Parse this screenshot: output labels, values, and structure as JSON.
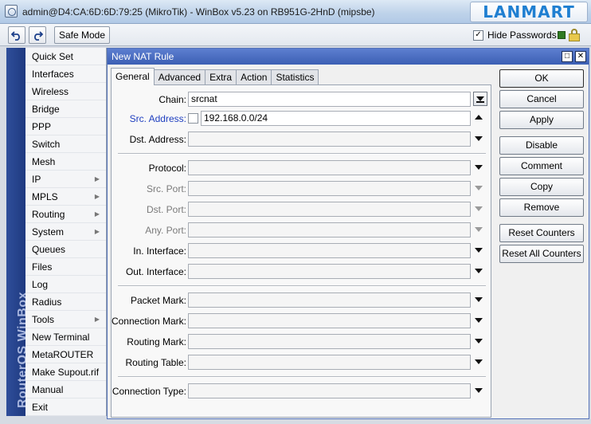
{
  "window": {
    "title": "admin@D4:CA:6D:6D:79:25 (MikroTik) - WinBox v5.23 on RB951G-2HnD (mipsbe)",
    "brand": "LANMART"
  },
  "toolbar": {
    "undo_icon": "undo-icon",
    "redo_icon": "redo-icon",
    "safe_mode_label": "Safe Mode",
    "hide_passwords_label": "Hide Passwords",
    "hide_passwords_checked": true,
    "status_color": "#2f7a22"
  },
  "sidebar": {
    "vertical_text": "RouterOS WinBox",
    "items": [
      {
        "label": "Quick Set",
        "submenu": false
      },
      {
        "label": "Interfaces",
        "submenu": false
      },
      {
        "label": "Wireless",
        "submenu": false
      },
      {
        "label": "Bridge",
        "submenu": false
      },
      {
        "label": "PPP",
        "submenu": false
      },
      {
        "label": "Switch",
        "submenu": false
      },
      {
        "label": "Mesh",
        "submenu": false
      },
      {
        "label": "IP",
        "submenu": true
      },
      {
        "label": "MPLS",
        "submenu": true
      },
      {
        "label": "Routing",
        "submenu": true
      },
      {
        "label": "System",
        "submenu": true
      },
      {
        "label": "Queues",
        "submenu": false
      },
      {
        "label": "Files",
        "submenu": false
      },
      {
        "label": "Log",
        "submenu": false
      },
      {
        "label": "Radius",
        "submenu": false
      },
      {
        "label": "Tools",
        "submenu": true
      },
      {
        "label": "New Terminal",
        "submenu": false
      },
      {
        "label": "MetaROUTER",
        "submenu": false
      },
      {
        "label": "Make Supout.rif",
        "submenu": false
      },
      {
        "label": "Manual",
        "submenu": false
      },
      {
        "label": "Exit",
        "submenu": false
      }
    ]
  },
  "dialog": {
    "title": "New NAT Rule",
    "tabs": [
      "General",
      "Advanced",
      "Extra",
      "Action",
      "Statistics"
    ],
    "active_tab": "General",
    "fields": {
      "chain": {
        "label": "Chain:",
        "value": "srcnat"
      },
      "src_address": {
        "label": "Src. Address:",
        "value": "192.168.0.0/24"
      },
      "dst_address": {
        "label": "Dst. Address:",
        "value": ""
      },
      "protocol": {
        "label": "Protocol:",
        "value": ""
      },
      "src_port": {
        "label": "Src. Port:",
        "value": ""
      },
      "dst_port": {
        "label": "Dst. Port:",
        "value": ""
      },
      "any_port": {
        "label": "Any. Port:",
        "value": ""
      },
      "in_interface": {
        "label": "In. Interface:",
        "value": ""
      },
      "out_interface": {
        "label": "Out. Interface:",
        "value": ""
      },
      "packet_mark": {
        "label": "Packet Mark:",
        "value": ""
      },
      "connection_mark": {
        "label": "Connection Mark:",
        "value": ""
      },
      "routing_mark": {
        "label": "Routing Mark:",
        "value": ""
      },
      "routing_table": {
        "label": "Routing Table:",
        "value": ""
      },
      "connection_type": {
        "label": "Connection Type:",
        "value": ""
      }
    },
    "buttons": {
      "ok": "OK",
      "cancel": "Cancel",
      "apply": "Apply",
      "disable": "Disable",
      "comment": "Comment",
      "copy": "Copy",
      "remove": "Remove",
      "reset_counters": "Reset Counters",
      "reset_all_counters": "Reset All Counters"
    }
  }
}
